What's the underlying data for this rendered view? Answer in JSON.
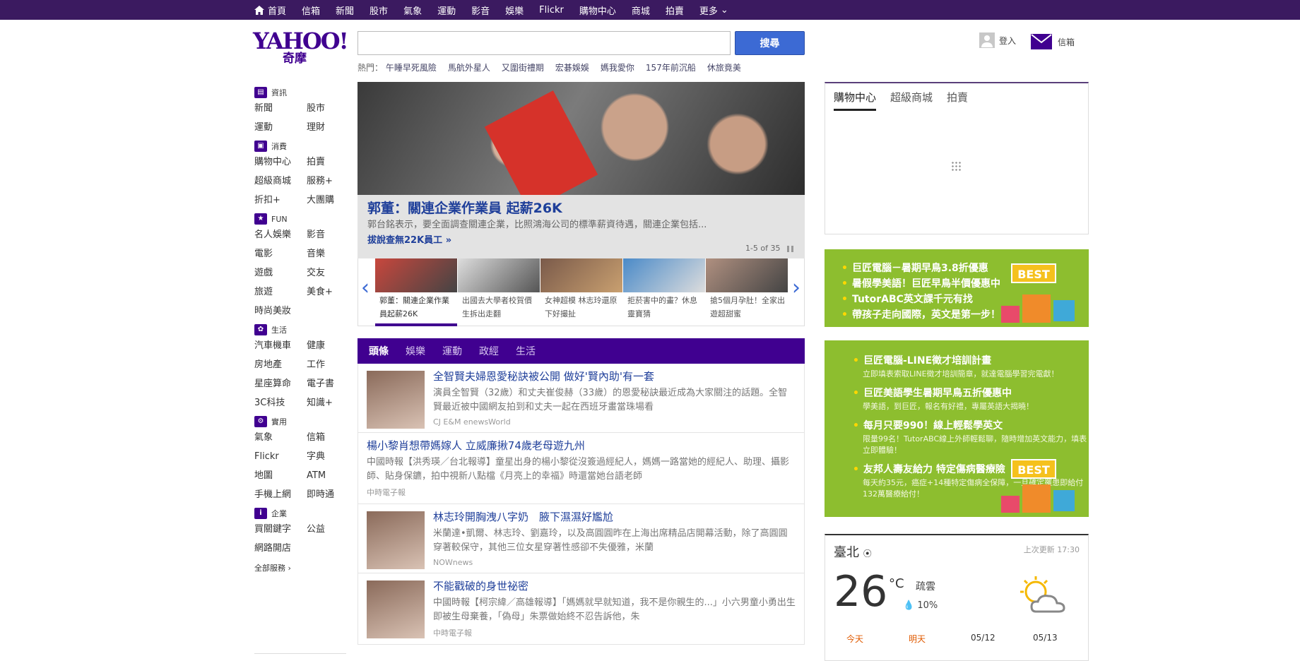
{
  "topnav": {
    "items": [
      "首頁",
      "信箱",
      "新聞",
      "股市",
      "氣象",
      "運動",
      "影音",
      "娛樂",
      "Flickr",
      "購物中心",
      "商城",
      "拍賣",
      "更多"
    ]
  },
  "header": {
    "logo_text": "YAHOO!",
    "logo_sub": "奇摩",
    "search_button": "搜尋",
    "search_value": "",
    "trending_label": "熱門：",
    "trending": [
      "午睡早死風險",
      "馬航外星人",
      "又圍街禮期",
      "宏碁娛娛",
      "媽我愛你",
      "157年前沉船",
      "休旅竟美"
    ],
    "login_label": "登入",
    "mail_label": "信箱"
  },
  "sidebar": {
    "sections": [
      {
        "title": "資訊",
        "icon": "news-icon",
        "links": [
          "新聞",
          "股市",
          "運動",
          "理財"
        ]
      },
      {
        "title": "消費",
        "icon": "shopping-bag-icon",
        "links": [
          "購物中心",
          "拍賣",
          "超級商城",
          "服務+",
          "折扣+",
          "大團購"
        ]
      },
      {
        "title": "FUN",
        "icon": "star-icon",
        "links": [
          "名人娛樂",
          "影音",
          "電影",
          "音樂",
          "遊戲",
          "交友",
          "旅遊",
          "美食+",
          "時尚美妝"
        ]
      },
      {
        "title": "生活",
        "icon": "life-icon",
        "links": [
          "汽車機車",
          "健康",
          "房地產",
          "工作",
          "星座算命",
          "電子書",
          "3C科技",
          "知識+"
        ]
      },
      {
        "title": "實用",
        "icon": "tools-icon",
        "links": [
          "氣象",
          "信箱",
          "Flickr",
          "字典",
          "地圖",
          "ATM",
          "手機上網",
          "即時通"
        ]
      },
      {
        "title": "企業",
        "icon": "info-icon",
        "links": [
          "買關鍵字",
          "公益",
          "網路開店"
        ]
      }
    ],
    "all_services": "全部服務"
  },
  "hero": {
    "title": "郭董：關連企業作業員 起薪26K",
    "desc": "郭台銘表示，要全面調查關連企業，比照鴻海公司的標準薪資待遇，關連企業包括...",
    "more": "拔說查無22K員工 »",
    "count": "1-5 of 35"
  },
  "thumbs": [
    "郭董：關連企業作業員起薪26K",
    "出國去大學者校賀價生拆出走翻",
    "女神超模 林志玲還原下好撮扯",
    "拒菸害中的畫？休息靈寶猜",
    "搶5個月孕肚！全家出遊超甜蜜"
  ],
  "news_tabs": [
    "頭條",
    "娛樂",
    "運動",
    "政經",
    "生活"
  ],
  "stories": [
    {
      "title": "全智賢夫婦恩愛秘訣被公開 做好'賢內助'有一套",
      "text": "演員全智賢（32歲）和丈夫崔俊赫（33歲）的恩愛秘訣最近成為大家關注的話題。全智賢最近被中國網友拍到和丈夫一起在西班牙畫當珠場看",
      "source": "CJ E&M enewsWorld",
      "img": true
    },
    {
      "title": "楊小黎肖想帶媽嫁人 立威廉揪74歲老母遊九州",
      "text": "中國時報【洪秀瑛／台北報導】童星出身的楊小黎從沒簽過經紀人，媽媽一路當她的經紀人、助理、攝影師、貼身保鑣，拍中視新八點檔《月亮上的幸福》時還當她台語老師",
      "source": "中時電子報",
      "img": false
    },
    {
      "title": "林志玲開胸洩八字奶　腋下濕濕好尷尬",
      "text": "米蘭達•凱爾、林志玲、劉嘉玲，以及高圓圓昨在上海出席精品店開幕活動，除了高圓圓穿著較保守，其他三位女星穿著性感卻不失優雅，米蘭",
      "source": "NOWnews",
      "img": true
    },
    {
      "title": "不能戳破的身世祕密",
      "text": "中國時報【柯宗緯／高雄報導】「媽媽就早就知道，我不是你親生的...」小六男童小勇出生即被生母棄養，「偽母」朱票做始終不忍告訴他，朱",
      "source": "中時電子報",
      "img": true
    }
  ],
  "shop": {
    "tabs": [
      "購物中心",
      "超級商城",
      "拍賣"
    ]
  },
  "ad1": {
    "lines": [
      "巨匠電腦－暑期早鳥3.8折優惠",
      "暑假學美語！巨匠早鳥半價優惠中",
      "TutorABC英文課千元有找",
      "帶孩子走向國際，英文是第一步！"
    ],
    "badge": "BEST"
  },
  "ad2": {
    "items": [
      {
        "title": "巨匠電腦-LINE徵才培訓計畫",
        "sub": "立即填表索取LINE徵才培訓簡章，就達電腦學習完電獻！"
      },
      {
        "title": "巨匠美語學生暑期早鳥五折優惠中",
        "sub": "學美語，到巨匠，報名有好禮，專屬英語大揭曉！"
      },
      {
        "title": "每月只要990！線上輕鬆學英文",
        "sub": "限量99名！TutorABC線上外師輕鬆聊，隨時增加英文能力，填表立即體驗！"
      },
      {
        "title": "友邦人壽友給力 特定傷病醫療險",
        "sub": "每天約35元，癌症+14種特定傷病全保障，一旦確定罹患即給付132萬醫療給付！"
      }
    ],
    "badge": "BEST"
  },
  "weather": {
    "city": "臺北",
    "updated": "上次更新 17:30",
    "temp": "26",
    "unit": "°C",
    "desc": "疏雲",
    "rain": "10%",
    "days": [
      "今天",
      "明天",
      "05/12",
      "05/13"
    ]
  },
  "colors": {
    "brand": "#400090",
    "topbar": "#3b1a60",
    "link": "#1f3f9a",
    "ad_green": "#8dbe2f"
  }
}
